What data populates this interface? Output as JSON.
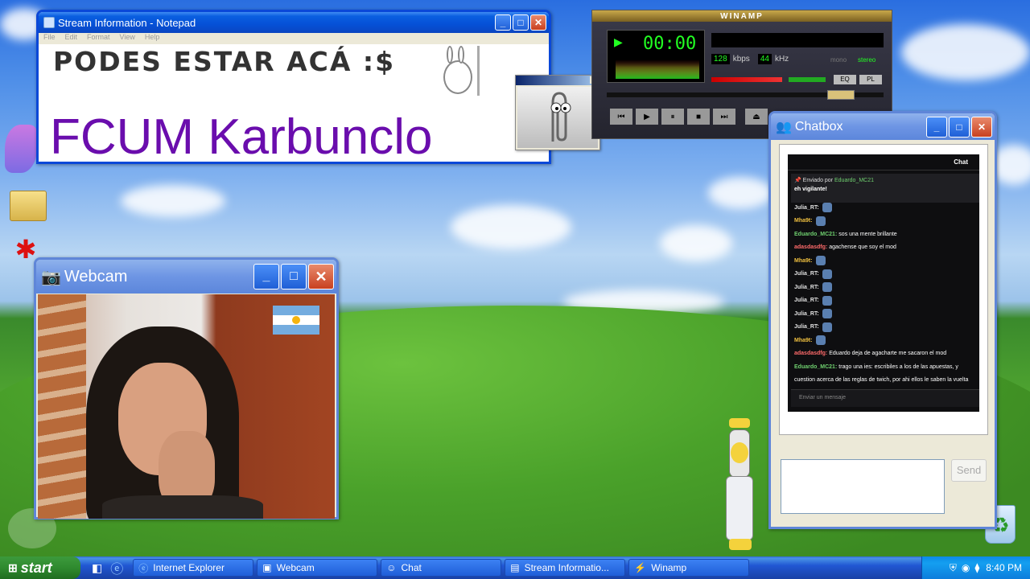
{
  "notepad": {
    "title": "Stream Information - Notepad",
    "menu": [
      "File",
      "Edit",
      "Format",
      "View",
      "Help"
    ],
    "line1": "PODES ESTAR ACÁ :$",
    "line2": "FCUM Karbunclo"
  },
  "winamp": {
    "title": "WINAMP",
    "time": "00:00",
    "kbps": "128",
    "kbps_label": "kbps",
    "khz": "44",
    "khz_label": "kHz",
    "mono": "mono",
    "stereo": "stereo",
    "eq": "EQ",
    "pl": "PL"
  },
  "webcam": {
    "title": "Webcam"
  },
  "chatbox": {
    "title": "Chatbox",
    "header": "Chat",
    "pinned_by": "Enviado por",
    "pinned_user": "Eduardo_MC21",
    "pinned_msg": "eh vigilante!",
    "messages": [
      {
        "user": "Julia_RT:",
        "text": "",
        "color": "#e0e0e0"
      },
      {
        "user": "Mha9t:",
        "text": "",
        "color": "#f0c040"
      },
      {
        "user": "Eduardo_MC21:",
        "text": "sos una mente brillante",
        "color": "#6fd06f"
      },
      {
        "user": "adasdasdfg:",
        "text": "agachense que soy el mod",
        "color": "#ff6b6b"
      },
      {
        "user": "Mha9t:",
        "text": "",
        "color": "#f0c040"
      },
      {
        "user": "Julia_RT:",
        "text": "",
        "color": "#e0e0e0"
      },
      {
        "user": "Julia_RT:",
        "text": "",
        "color": "#e0e0e0"
      },
      {
        "user": "Julia_RT:",
        "text": "",
        "color": "#e0e0e0"
      },
      {
        "user": "Julia_RT:",
        "text": "",
        "color": "#e0e0e0"
      },
      {
        "user": "Julia_RT:",
        "text": "",
        "color": "#e0e0e0"
      },
      {
        "user": "Mha9t:",
        "text": "",
        "color": "#f0c040"
      },
      {
        "user": "adasdasdfg:",
        "text": "Eduardo deja de agacharte me sacaron el mod",
        "color": "#ff6b6b"
      },
      {
        "user": "Eduardo_MC21:",
        "text": "trago una ies: escribiles a los de las apuestas, y",
        "color": "#6fd06f"
      },
      {
        "user": "",
        "text": "cuestion acerca de las reglas de twich, por ahi ellos le saben la vuelta",
        "color": "#e0e0e0"
      }
    ],
    "input_placeholder": "Enviar un mensaje",
    "send": "Send"
  },
  "taskbar": {
    "start": "start",
    "items": [
      "Internet Explorer",
      "Webcam",
      "Chat",
      "Stream Informatio...",
      "Winamp"
    ],
    "clock": "8:40 PM"
  },
  "colors": {
    "xp_blue": "#0a48d8",
    "purple_text": "#6a0dad"
  }
}
